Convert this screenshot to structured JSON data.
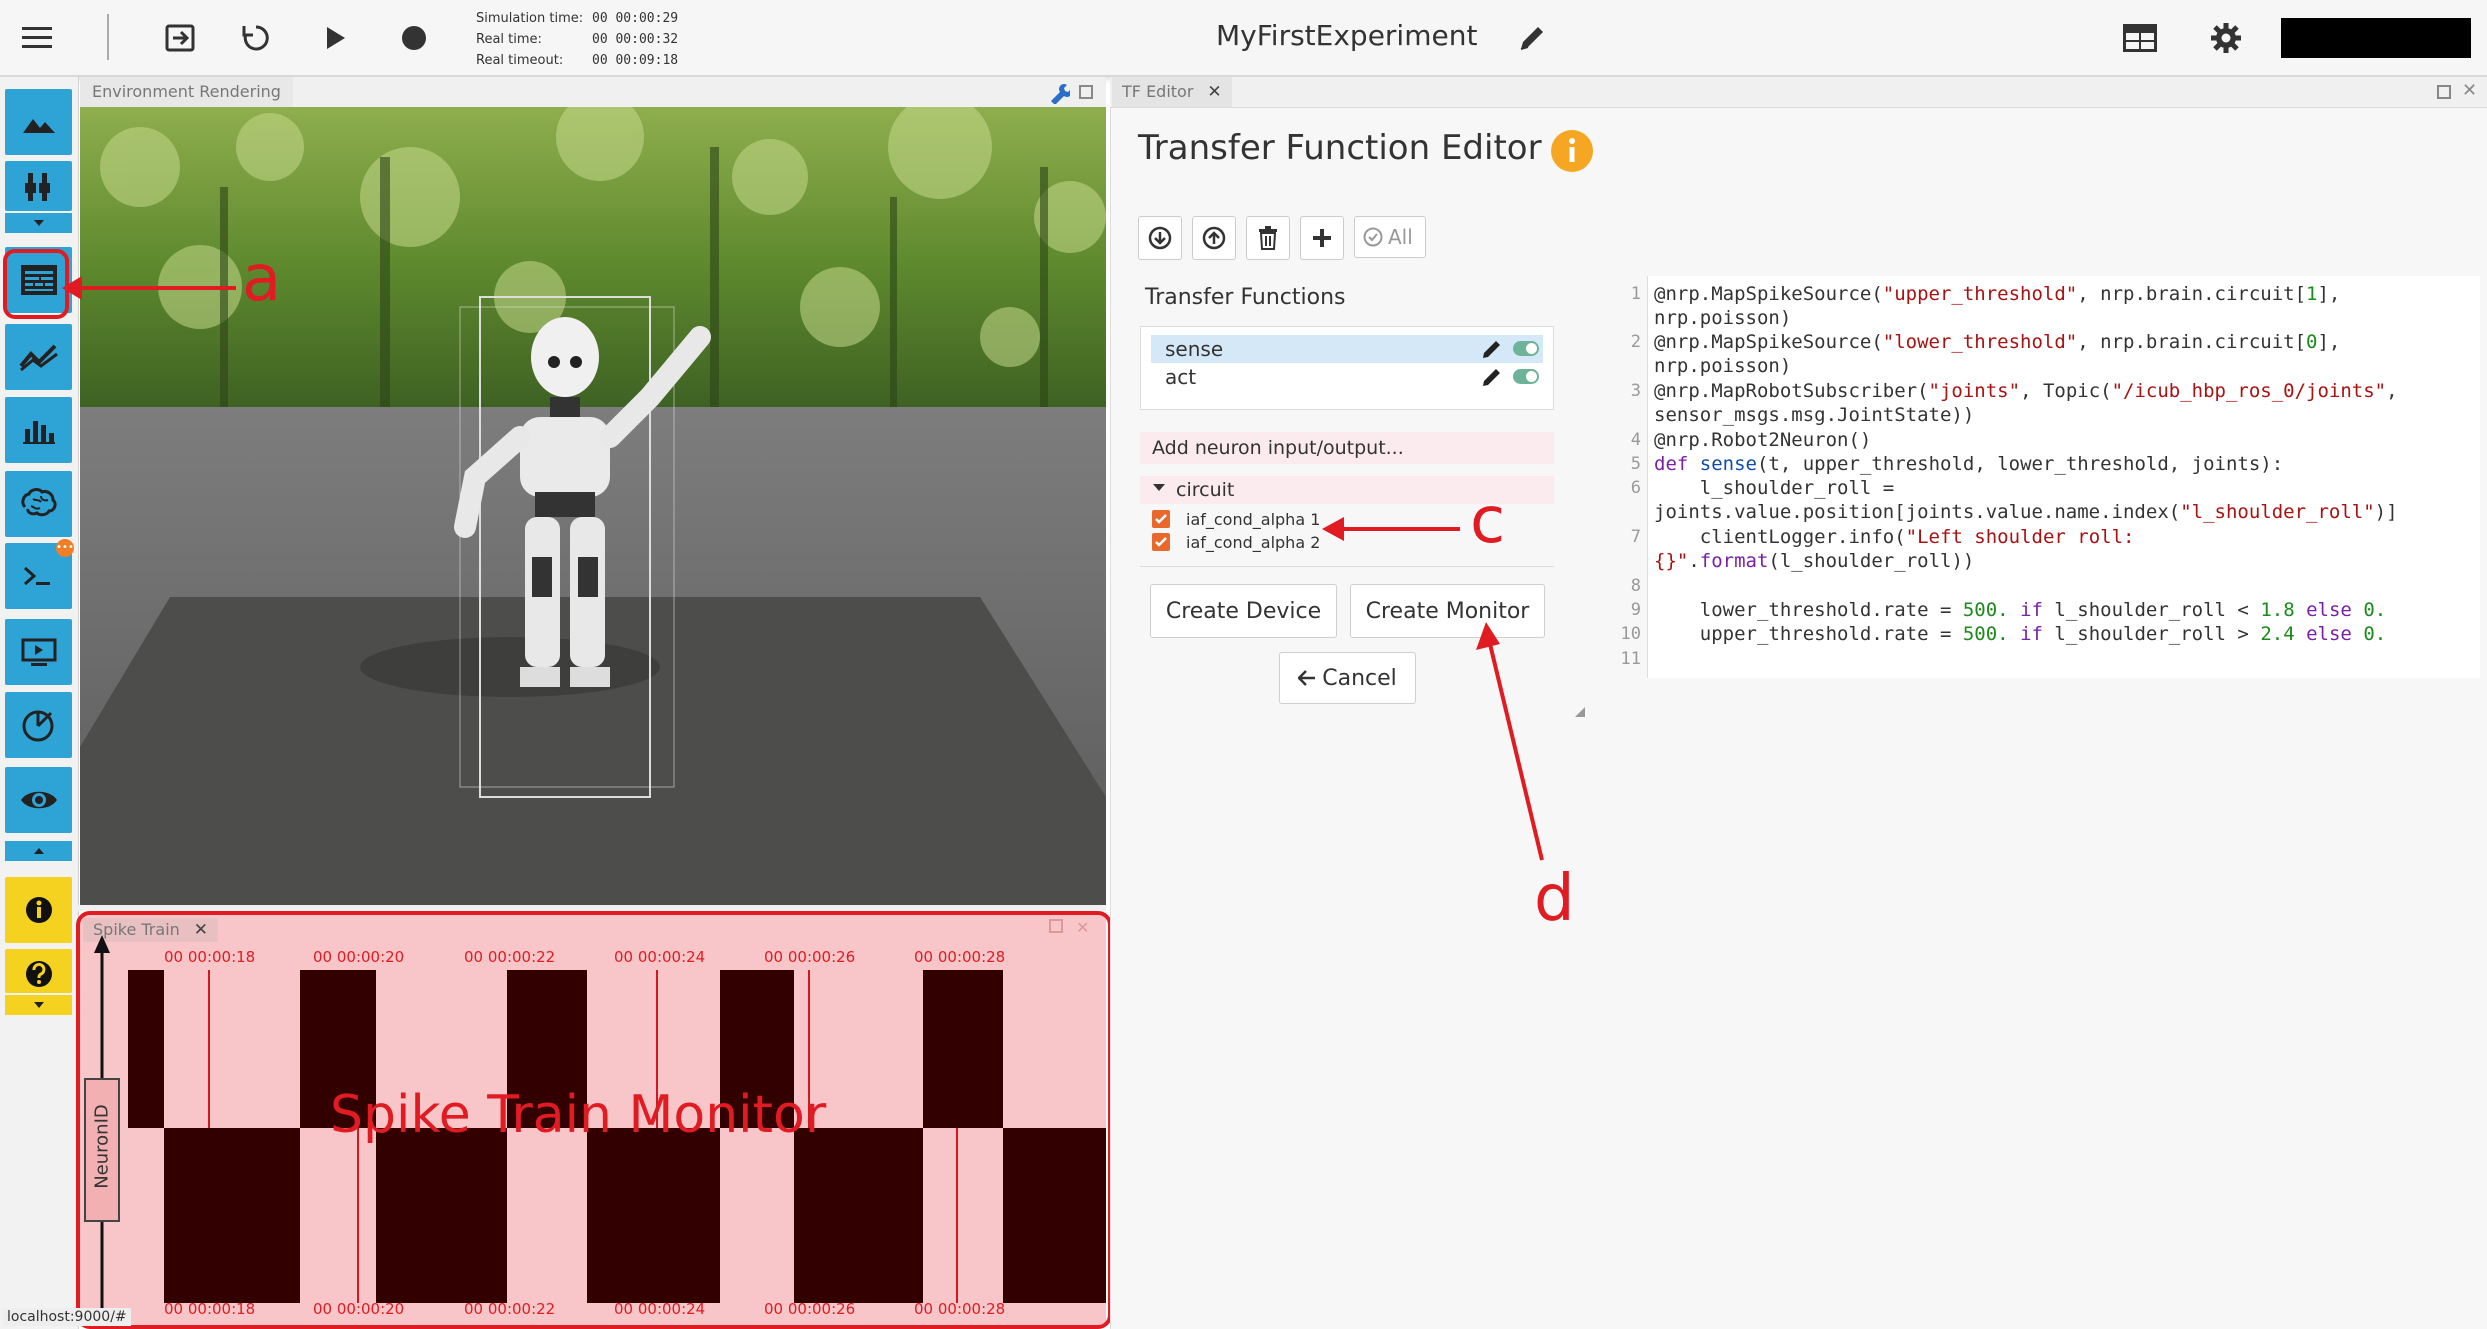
{
  "topbar": {
    "sim_time_label": "Simulation time:",
    "sim_time_value": "00 00:00:29",
    "real_time_label": "Real time:",
    "real_time_value": "00 00:00:32",
    "timeout_label": "Real timeout:",
    "timeout_value": "00 00:09:18",
    "experiment_title": "MyFirstExperiment"
  },
  "env_panel": {
    "tab_label": "Environment Rendering"
  },
  "spike_panel": {
    "tab_label": "Spike Train",
    "y_label": "NeuronID",
    "ticks": [
      "00 00:00:18",
      "00 00:00:20",
      "00 00:00:22",
      "00 00:00:24",
      "00 00:00:26",
      "00 00:00:28"
    ],
    "overlay_label": "Spike Train Monitor"
  },
  "tf_panel": {
    "tab_label": "TF Editor",
    "title": "Transfer Function Editor",
    "all_label": "All",
    "section_label": "Transfer Functions",
    "functions": [
      "sense",
      "act"
    ],
    "add_neuron_label": "Add neuron input/output...",
    "group_label": "circuit",
    "neurons": [
      "iaf_cond_alpha 1",
      "iaf_cond_alpha 2"
    ],
    "create_device_label": "Create Device",
    "create_monitor_label": "Create Monitor",
    "cancel_label": "Cancel"
  },
  "code": {
    "line_numbers": [
      "1",
      "2",
      "3",
      "4",
      "5",
      "6",
      "7",
      "8",
      "9",
      "10",
      "11"
    ]
  },
  "annotations": {
    "a": "a",
    "c": "c",
    "d": "d"
  },
  "status_url": "localhost:9000/#",
  "icons": [
    "menu-icon",
    "exit-icon",
    "reset-icon",
    "play-icon",
    "record-icon",
    "pencil-icon",
    "layout-icon",
    "gear-icon",
    "environment-icon",
    "robot-icon",
    "tf-editor-icon",
    "graph-icon",
    "bar-chart-icon",
    "brain-icon",
    "terminal-icon",
    "video-icon",
    "joint-icon",
    "eye-icon",
    "info-icon",
    "help-icon"
  ],
  "colors": {
    "accent": "#2ea3d6",
    "highlight": "#e01b22",
    "spike_bg": "#f8c6c8",
    "spike_dark": "#300000"
  }
}
